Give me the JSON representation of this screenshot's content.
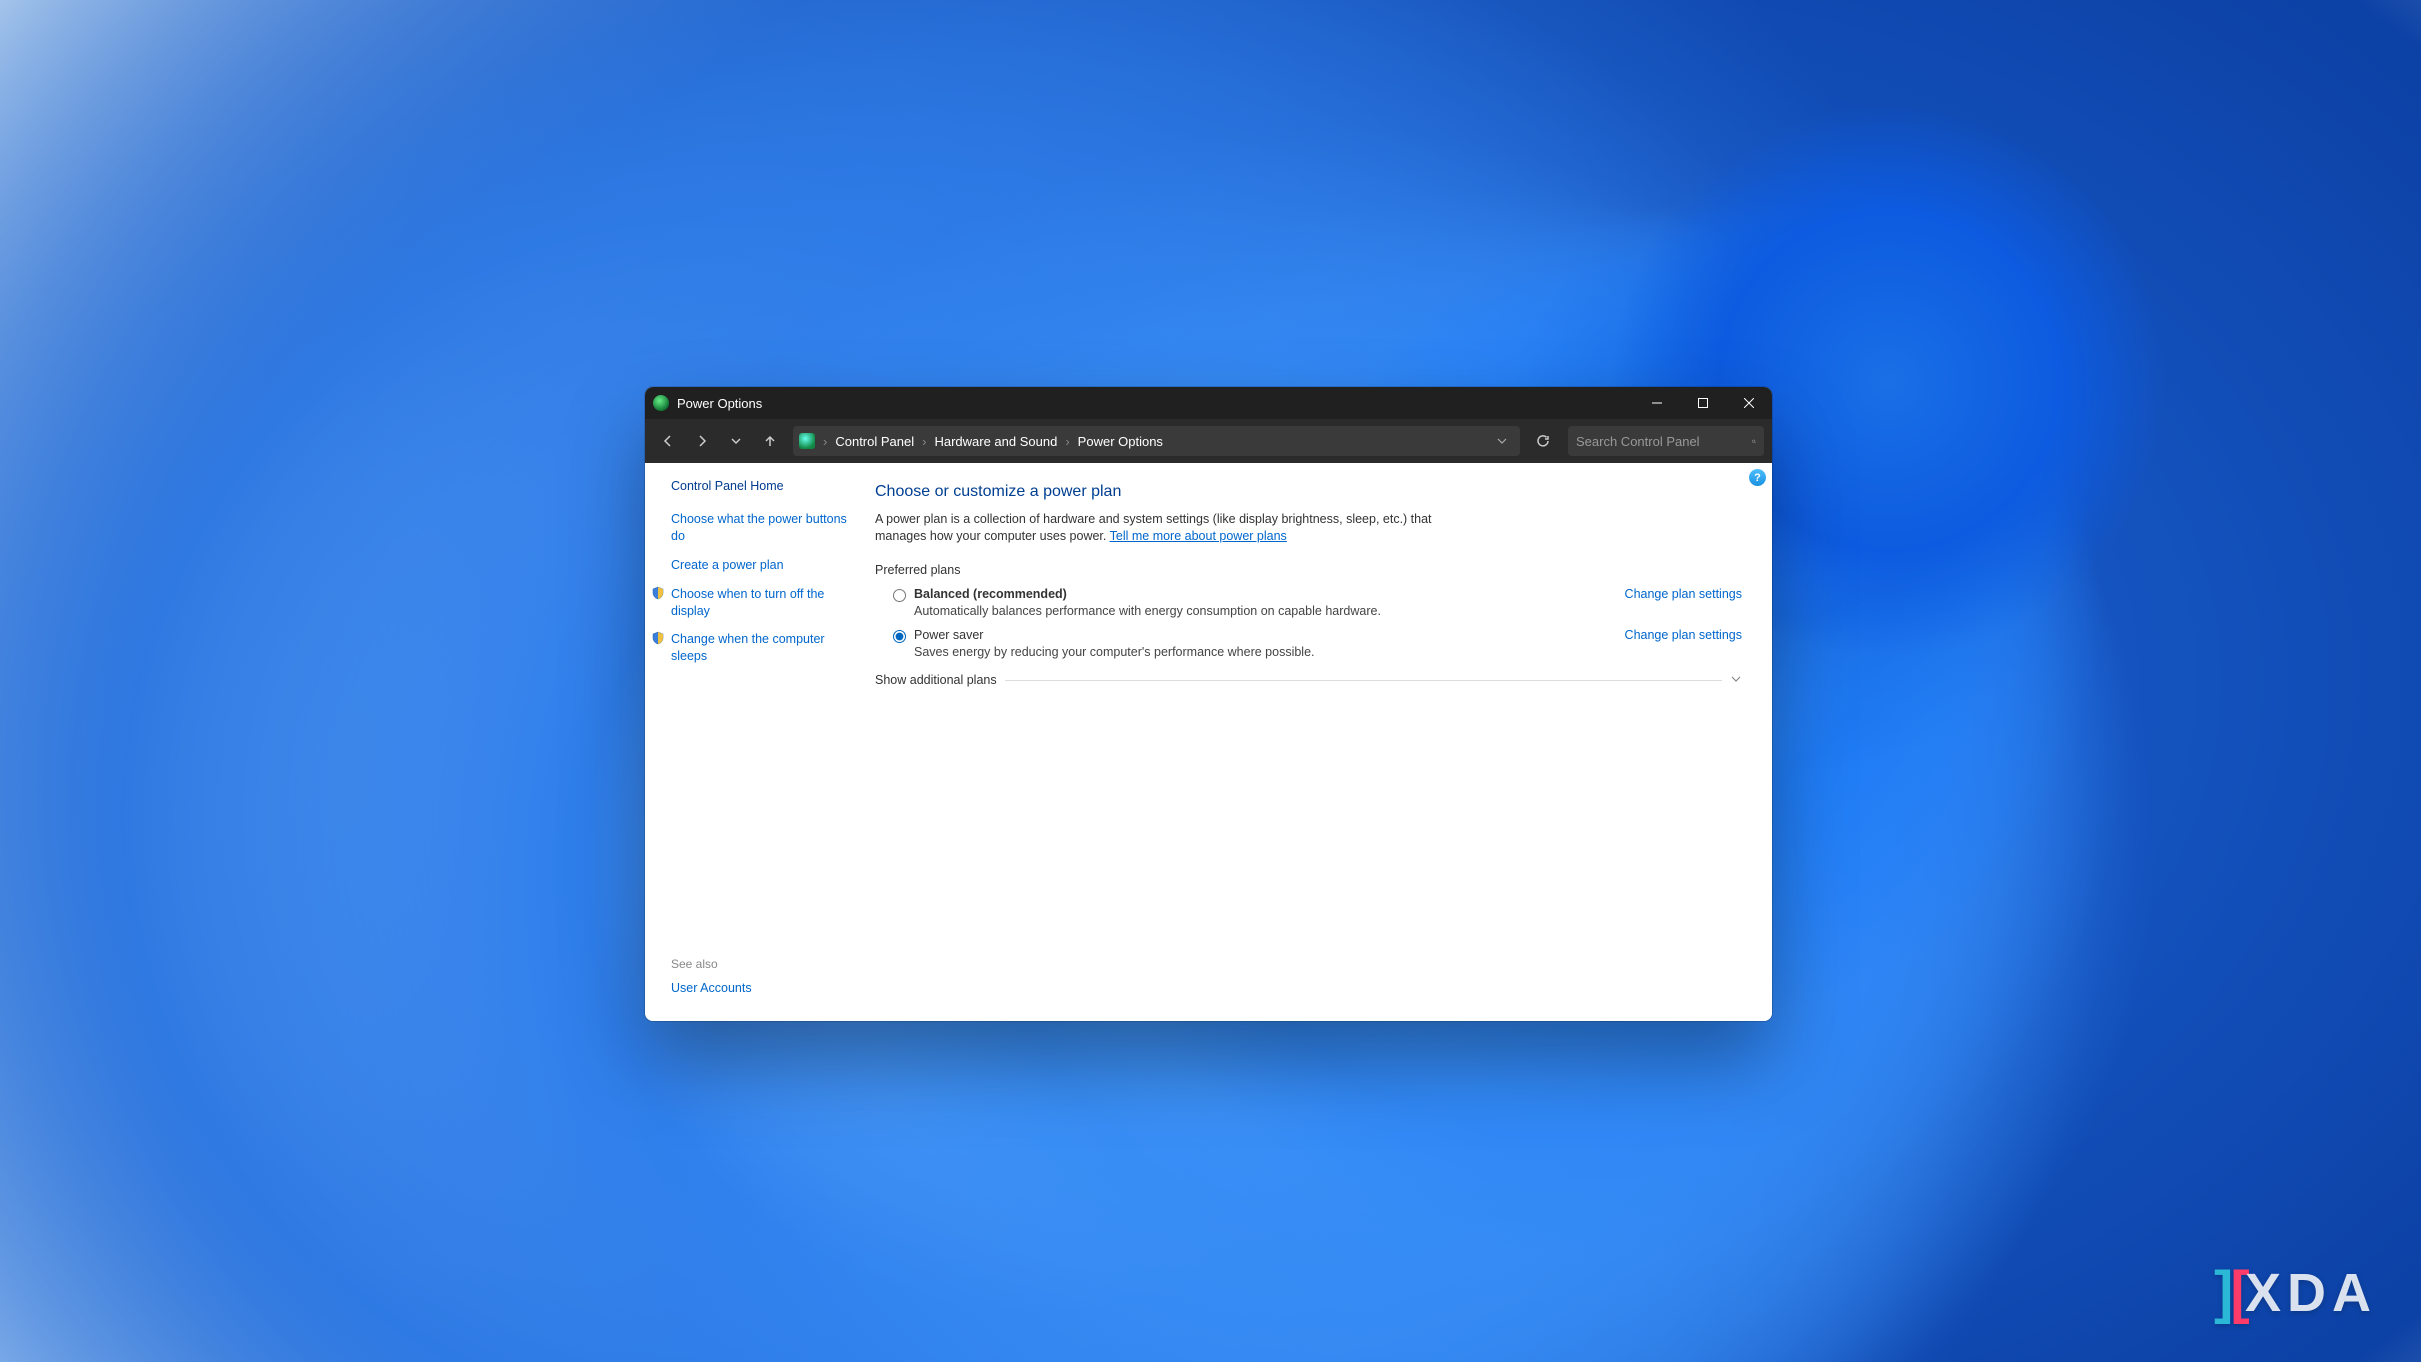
{
  "titlebar": {
    "title": "Power Options"
  },
  "breadcrumb": {
    "items": [
      "Control Panel",
      "Hardware and Sound",
      "Power Options"
    ]
  },
  "search": {
    "placeholder": "Search Control Panel"
  },
  "sidebar": {
    "home": "Control Panel Home",
    "links": [
      "Choose what the power buttons do",
      "Create a power plan",
      "Choose when to turn off the display",
      "Change when the computer sleeps"
    ],
    "see_also_label": "See also",
    "see_also_links": [
      "User Accounts"
    ]
  },
  "main": {
    "title": "Choose or customize a power plan",
    "description": "A power plan is a collection of hardware and system settings (like display brightness, sleep, etc.) that manages how your computer uses power. ",
    "description_link": "Tell me more about power plans",
    "preferred_label": "Preferred plans",
    "plans": [
      {
        "name": "Balanced (recommended)",
        "desc": "Automatically balances performance with energy consumption on capable hardware.",
        "selected": false,
        "change_label": "Change plan settings"
      },
      {
        "name": "Power saver",
        "desc": "Saves energy by reducing your computer's performance where possible.",
        "selected": true,
        "change_label": "Change plan settings"
      }
    ],
    "show_additional": "Show additional plans",
    "help_badge": "?"
  },
  "watermark": {
    "text": "XDA"
  }
}
